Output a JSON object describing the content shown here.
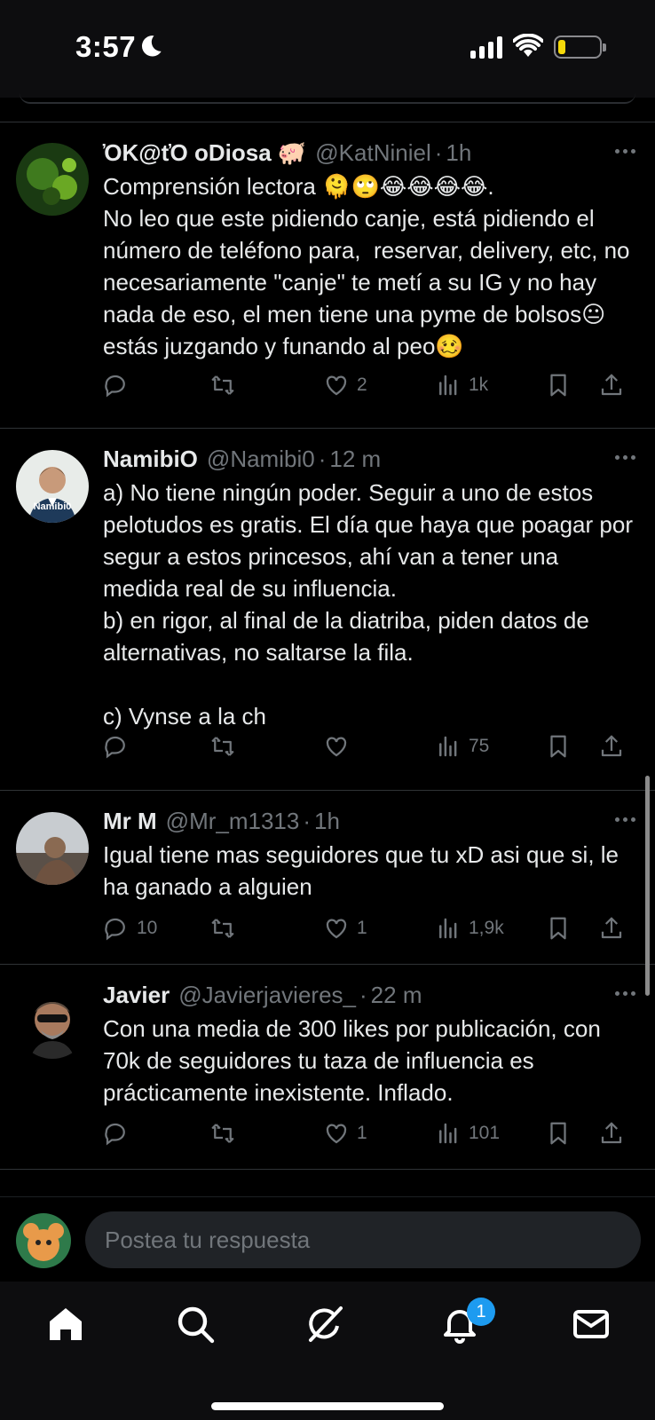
{
  "status_bar": {
    "time": "3:57"
  },
  "tweets": [
    {
      "name": "ὈK@tὈ oDiosa 🐖",
      "handle": "@KatNiniel",
      "separator": "·",
      "time": "1h",
      "text": "Comprensión lectora 🫠🙄😂😂😂😂.\nNo leo que este pidiendo canje, está pidiendo el número de teléfono para,  reservar, delivery, etc, no necesariamente \"canje\" te metí a su IG y no hay nada de eso, el men tiene una pyme de bolsos😐  estás juzgando y funando al peo🥴",
      "replies": "",
      "retweets": "",
      "likes": "2",
      "views": "1k"
    },
    {
      "name": "NamibiO",
      "handle": "@Namibi0",
      "separator": "·",
      "time": "12 m",
      "avatar_label": "Namibi0",
      "text": "a) No tiene ningún poder. Seguir a uno de estos pelotudos es gratis. El día que haya que poagar por segur a estos princesos, ahí van a tener una medida real de su influencia.\nb) en rigor, al final de la diatriba, piden datos de alternativas, no saltarse la fila.\n\nc) Vynse a la ch",
      "replies": "",
      "retweets": "",
      "likes": "",
      "views": "75"
    },
    {
      "name": "Mr M",
      "handle": "@Mr_m1313",
      "separator": "·",
      "time": "1h",
      "text": "Igual tiene mas seguidores que tu xD asi que si, le ha ganado a alguien",
      "replies": "10",
      "retweets": "",
      "likes": "1",
      "views": "1,9k"
    },
    {
      "name": "Javier",
      "handle": "@Javierjavieres_",
      "separator": "·",
      "time": "22 m",
      "text": "Con una media de 300 likes por publicación, con 70k de seguidores tu taza de influencia es prácticamente inexistente. Inflado.",
      "replies": "",
      "retweets": "",
      "likes": "1",
      "views": "101"
    }
  ],
  "reply": {
    "placeholder": "Postea tu respuesta"
  },
  "nav": {
    "notifications_badge": "1"
  }
}
